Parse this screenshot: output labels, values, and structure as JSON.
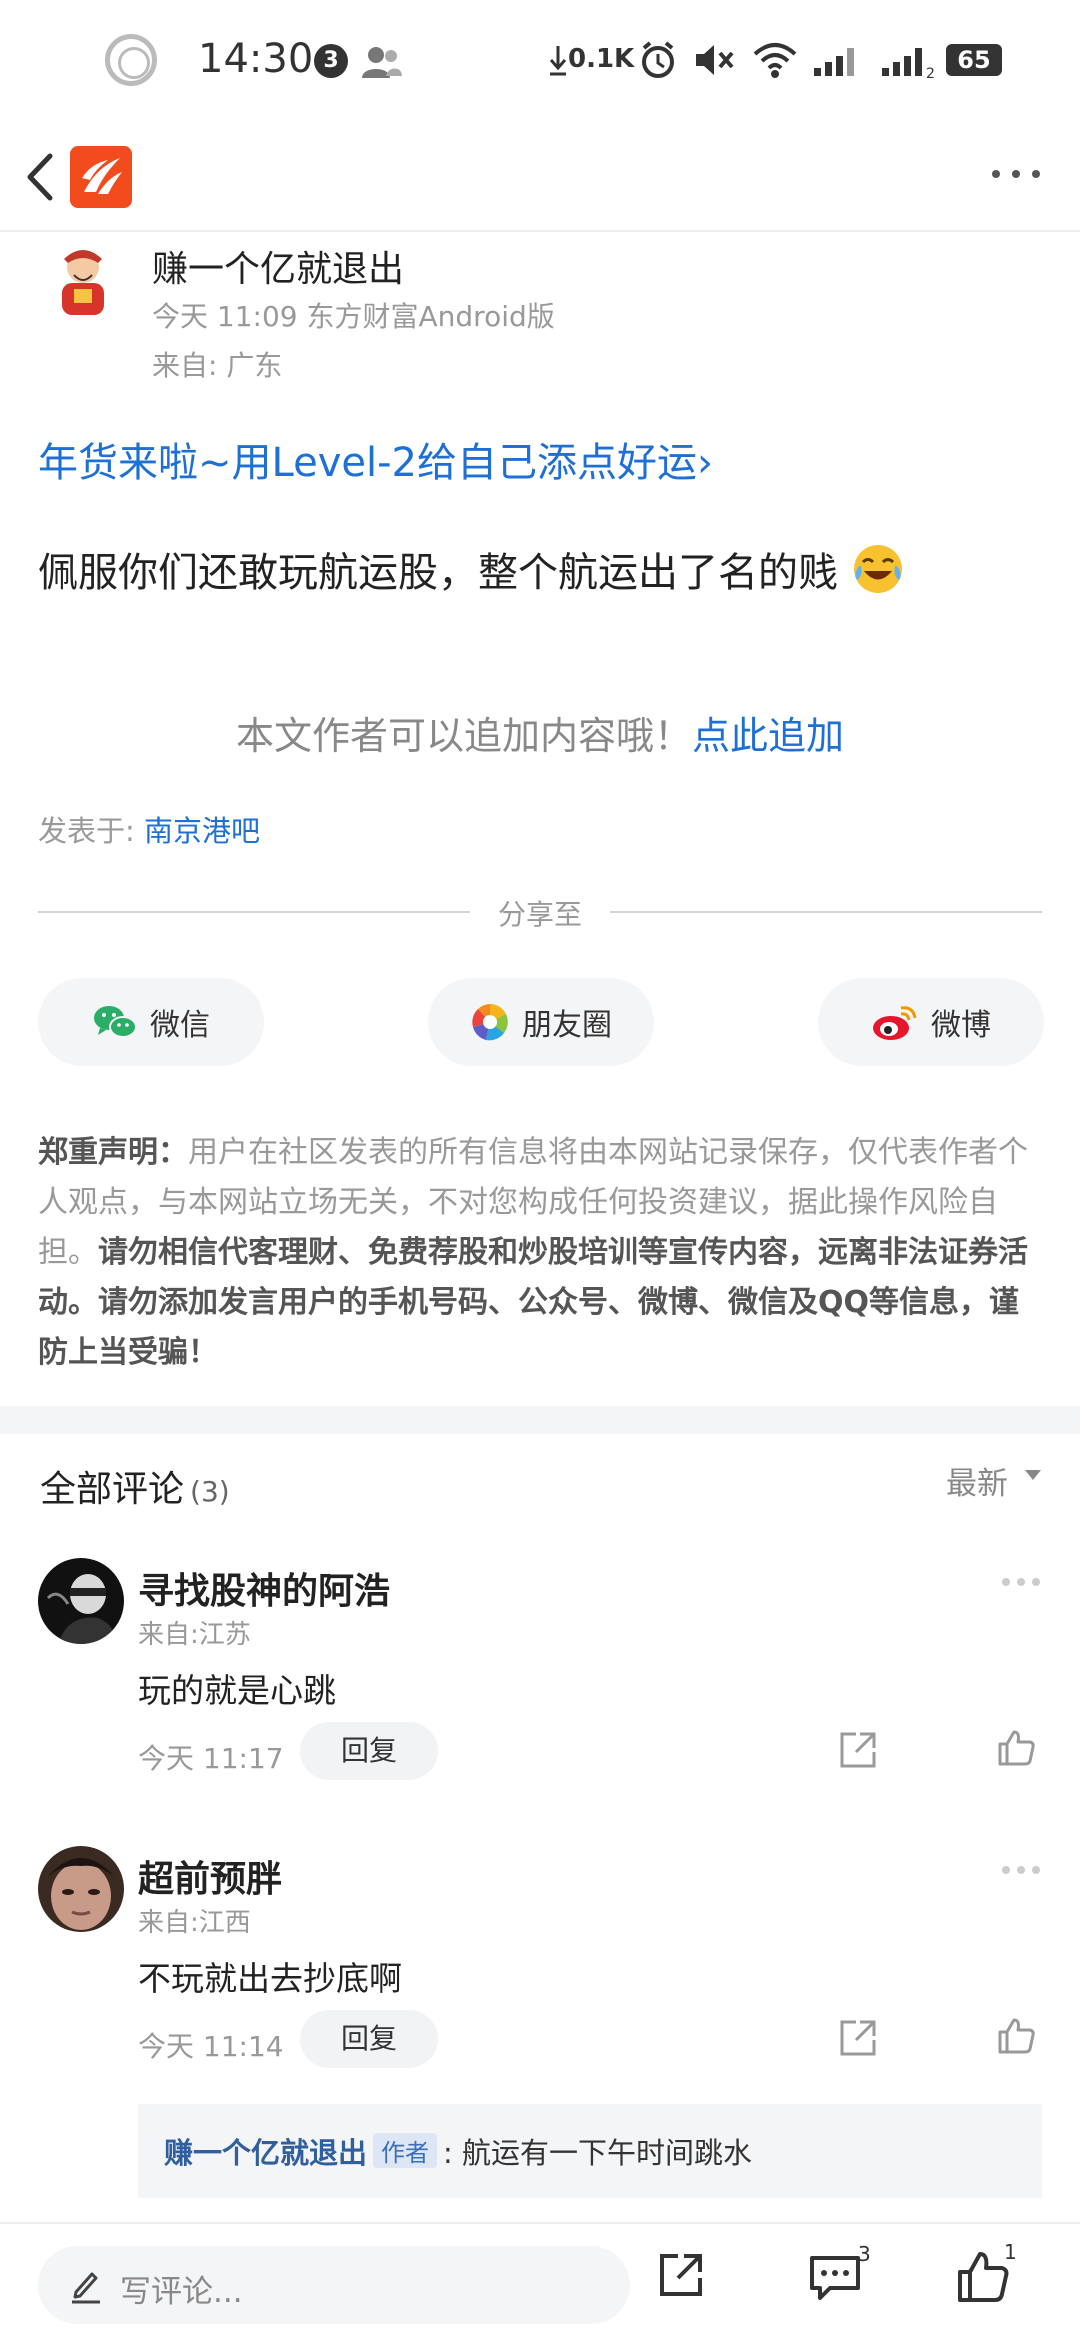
{
  "status_bar": {
    "time": "14:30",
    "notif_count": "3",
    "net_speed": "0.1K",
    "battery": "65"
  },
  "post": {
    "author_name": "赚一个亿就退出",
    "meta": "今天 11:09 东方财富Android版",
    "location": "来自: 广东",
    "promo_text": "年货来啦~用Level-2给自己添点好运",
    "promo_arrow": "›",
    "body": "佩服你们还敢玩航运股，整个航运出了名的贱",
    "append_prompt": "本文作者可以追加内容哦！",
    "append_link": "点此追加",
    "posted_in_label": "发表于: ",
    "forum_name": "南京港吧"
  },
  "share": {
    "label": "分享至",
    "wechat": "微信",
    "moments": "朋友圈",
    "weibo": "微博"
  },
  "disclaimer": {
    "lead": "郑重声明：",
    "normal": "用户在社区发表的所有信息将由本网站记录保存，仅代表作者个人观点，与本网站立场无关，不对您构成任何投资建议，据此操作风险自担。",
    "bold": "请勿相信代客理财、免费荐股和炒股培训等宣传内容，远离非法证券活动。请勿添加发言用户的手机号码、公众号、微博、微信及QQ等信息，谨防上当受骗！"
  },
  "comments": {
    "title": "全部评论",
    "count": "(3)",
    "sort": "最新",
    "items": [
      {
        "name": "寻找股神的阿浩",
        "location": "来自:江苏",
        "text": "玩的就是心跳",
        "time": "今天 11:17",
        "reply_label": "回复"
      },
      {
        "name": "超前预胖",
        "location": "来自:江西",
        "text": "不玩就出去抄底啊",
        "time": "今天 11:14",
        "reply_label": "回复"
      }
    ],
    "sub_reply": {
      "name": "赚一个亿就退出",
      "tag": "作者",
      "text": ": 航运有一下午时间跳水"
    }
  },
  "bottom_bar": {
    "input_placeholder": "写评论...",
    "comment_count": "3",
    "like_count": "1"
  }
}
